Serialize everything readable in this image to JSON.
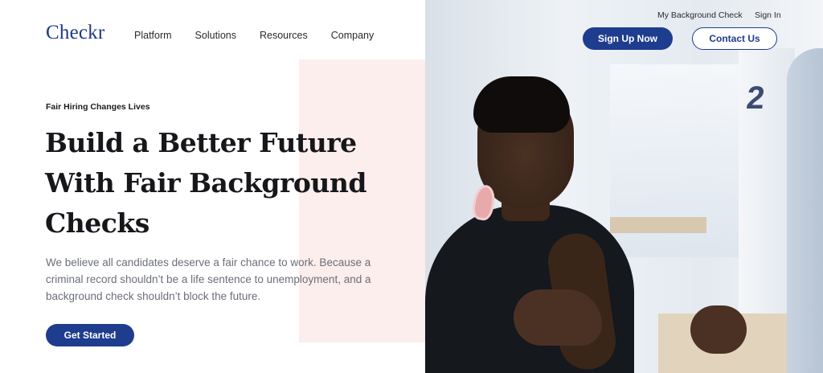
{
  "header": {
    "logo": "Checkr",
    "nav": [
      "Platform",
      "Solutions",
      "Resources",
      "Company"
    ],
    "utility_links": [
      "My Background Check",
      "Sign In"
    ],
    "sign_up_label": "Sign Up Now",
    "contact_label": "Contact Us"
  },
  "hero": {
    "eyebrow": "Fair Hiring Changes Lives",
    "headline_lines": [
      "Build a Better Future",
      "With Fair Background",
      "Checks"
    ],
    "body": "We believe all candidates deserve a fair chance to work. Because a criminal record shouldn’t be a life sentence to unemployment, and a background check shouldn’t block the future.",
    "cta_label": "Get Started",
    "photo_number": "2"
  },
  "colors": {
    "brand_blue": "#1e3d8f",
    "accent_pink": "#fbeeed"
  }
}
